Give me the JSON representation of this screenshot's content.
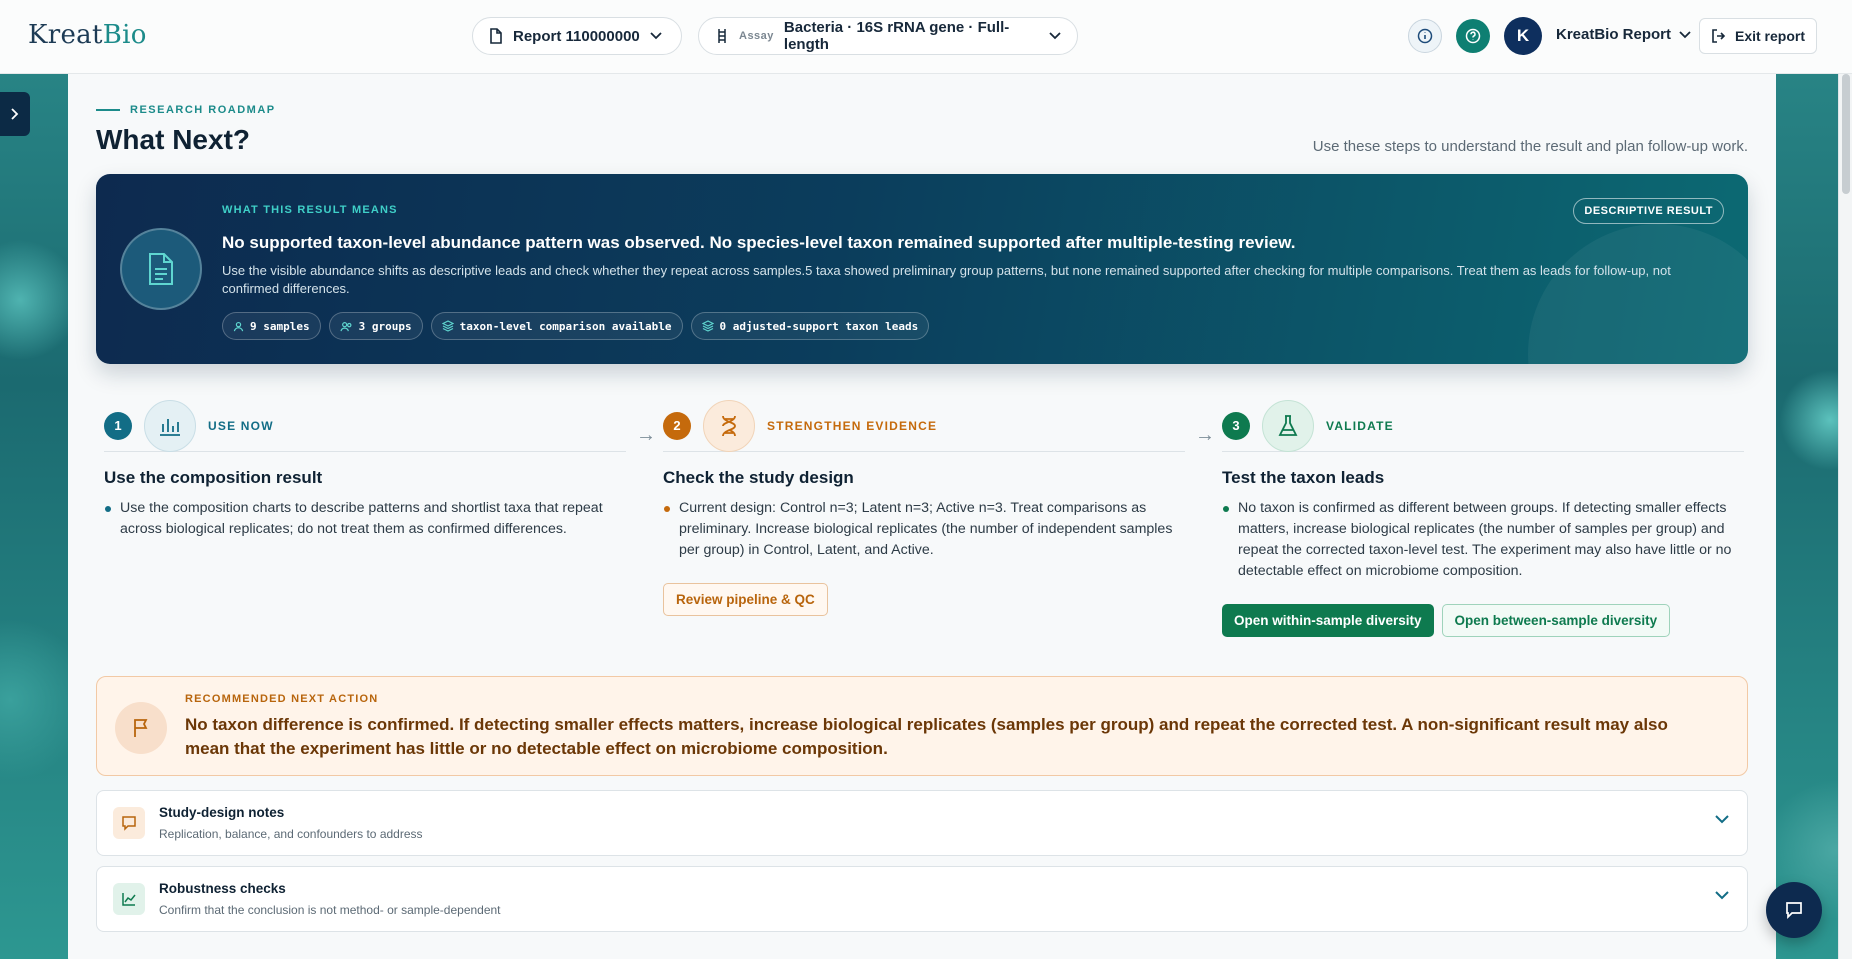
{
  "header": {
    "logo_part1": "Kreat",
    "logo_part2": "Bio",
    "report_label": "Report 110000000",
    "assay_prefix": "Assay",
    "assay_value": "Bacteria · 16S rRNA gene · Full-length",
    "avatar_initial": "K",
    "user_name": "KreatBio Report",
    "exit_label": "Exit report"
  },
  "section": {
    "eyebrow": "RESEARCH ROADMAP",
    "title": "What Next?",
    "subtitle": "Use these steps to understand the result and plan follow-up work."
  },
  "hero": {
    "eyebrow": "WHAT THIS RESULT MEANS",
    "headline": "No supported taxon-level abundance pattern was observed. No species-level taxon remained supported after multiple-testing review.",
    "body": "Use the visible abundance shifts as descriptive leads and check whether they repeat across samples.5 taxa showed preliminary group patterns, but none remained supported after checking for multiple comparisons. Treat them as leads for follow-up, not confirmed differences.",
    "badge": "DESCRIPTIVE RESULT",
    "chips": [
      "9 samples",
      "3 groups",
      "taxon-level comparison available",
      "0 adjusted-support taxon leads"
    ]
  },
  "steps": [
    {
      "num": "1",
      "label": "USE NOW",
      "title": "Use the composition result",
      "bullet": "Use the composition charts to describe patterns and shortlist taxa that repeat across biological replicates; do not treat them as confirmed differences."
    },
    {
      "num": "2",
      "label": "STRENGTHEN EVIDENCE",
      "title": "Check the study design",
      "bullet": "Current design: Control n=3; Latent n=3; Active n=3. Treat comparisons as preliminary. Increase biological replicates (the number of independent samples per group) in Control, Latent, and Active.",
      "button": "Review pipeline & QC"
    },
    {
      "num": "3",
      "label": "VALIDATE",
      "title": "Test the taxon leads",
      "bullet": "No taxon is confirmed as different between groups. If detecting smaller effects matters, increase biological replicates (the number of samples per group) and repeat the corrected taxon-level test. The experiment may also have little or no detectable effect on microbiome composition.",
      "button_primary": "Open within-sample diversity",
      "button_secondary": "Open between-sample diversity"
    }
  ],
  "recommend": {
    "eyebrow": "RECOMMENDED NEXT ACTION",
    "text": "No taxon difference is confirmed. If detecting smaller effects matters, increase biological replicates (samples per group) and repeat the corrected test. A non-significant result may also mean that the experiment has little or no detectable effect on microbiome composition."
  },
  "accordions": [
    {
      "title": "Study-design notes",
      "sub": "Replication, balance, and confounders to address"
    },
    {
      "title": "Robustness checks",
      "sub": "Confirm that the conclusion is not method- or sample-dependent"
    }
  ],
  "colors": {
    "teal": "#1c8b8a",
    "navy": "#0d2a4f",
    "orange": "#c56a0c",
    "green": "#0e7a4f"
  }
}
